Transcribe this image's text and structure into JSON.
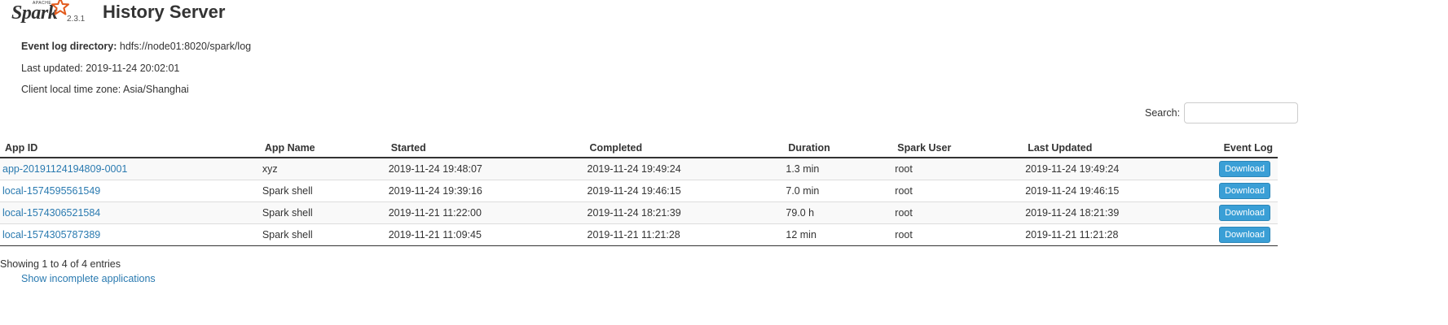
{
  "header": {
    "logo_apache": "APACHE",
    "logo_spark": "Spark",
    "version": "2.3.1",
    "title": "History Server"
  },
  "info": {
    "event_log_label": "Event log directory:",
    "event_log_value": "hdfs://node01:8020/spark/log",
    "last_updated": "Last updated: 2019-11-24 20:02:01",
    "timezone": "Client local time zone: Asia/Shanghai"
  },
  "search": {
    "label": "Search:",
    "value": ""
  },
  "table": {
    "columns": [
      "App ID",
      "App Name",
      "Started",
      "Completed",
      "Duration",
      "Spark User",
      "Last Updated",
      "Event Log"
    ],
    "rows": [
      {
        "app_id": "app-20191124194809-0001",
        "app_name": "xyz",
        "started": "2019-11-24 19:48:07",
        "completed": "2019-11-24 19:49:24",
        "duration": "1.3 min",
        "user": "root",
        "last_updated": "2019-11-24 19:49:24",
        "event_log": "Download"
      },
      {
        "app_id": "local-1574595561549",
        "app_name": "Spark shell",
        "started": "2019-11-24 19:39:16",
        "completed": "2019-11-24 19:46:15",
        "duration": "7.0 min",
        "user": "root",
        "last_updated": "2019-11-24 19:46:15",
        "event_log": "Download"
      },
      {
        "app_id": "local-1574306521584",
        "app_name": "Spark shell",
        "started": "2019-11-21 11:22:00",
        "completed": "2019-11-24 18:21:39",
        "duration": "79.0 h",
        "user": "root",
        "last_updated": "2019-11-24 18:21:39",
        "event_log": "Download"
      },
      {
        "app_id": "local-1574305787389",
        "app_name": "Spark shell",
        "started": "2019-11-21 11:09:45",
        "completed": "2019-11-21 11:21:28",
        "duration": "12 min",
        "user": "root",
        "last_updated": "2019-11-21 11:21:28",
        "event_log": "Download"
      }
    ]
  },
  "footer": {
    "showing": "Showing 1 to 4 of 4 entries",
    "incomplete_link": "Show incomplete applications"
  },
  "colors": {
    "link": "#2a7ab0",
    "download_button": "#3a9fd6",
    "logo_star": "#e25a1c"
  }
}
